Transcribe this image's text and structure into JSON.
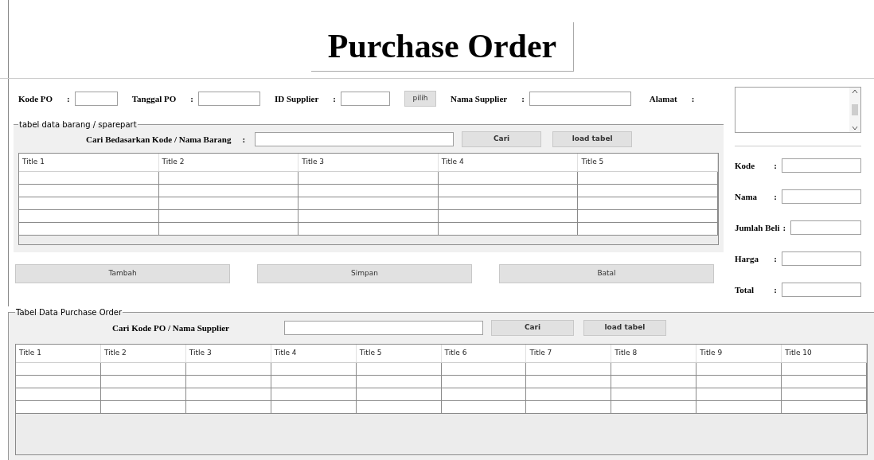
{
  "title": "Purchase Order",
  "header_fields": [
    {
      "label": "Kode PO",
      "colon": ":",
      "kind": "input"
    },
    {
      "label": "Tanggal PO",
      "colon": ":",
      "kind": "input"
    },
    {
      "label": "ID Supplier",
      "colon": ":",
      "kind": "input"
    },
    {
      "label": "pilih",
      "kind": "button"
    },
    {
      "label": "Nama Supplier",
      "colon": ":",
      "kind": "input"
    },
    {
      "label": "Alamat",
      "colon": ":",
      "kind": "label"
    }
  ],
  "item_group": {
    "legend": "tabel data barang / sparepart",
    "search_label": "Cari Bedasarkan Kode / Nama Barang",
    "colon": ":",
    "buttons": [
      "Cari",
      "load tabel"
    ],
    "columns": [
      "Title 1",
      "Title 2",
      "Title 3",
      "Title 4",
      "Title 5"
    ]
  },
  "actions": [
    "Tambah",
    "Simpan",
    "Batal"
  ],
  "item_fields": [
    {
      "label": "Kode",
      "colon": ":"
    },
    {
      "label": "Nama",
      "colon": ":"
    },
    {
      "label": "Jumlah Beli",
      "colon": ":"
    },
    {
      "label": "Harga",
      "colon": ":"
    },
    {
      "label": "Total",
      "colon": ":"
    }
  ],
  "po_group": {
    "legend": "Tabel Data Purchase Order",
    "search_label": "Cari Kode PO / Nama Supplier",
    "buttons": [
      "Cari",
      "load tabel"
    ],
    "columns": [
      "Title 1",
      "Title 2",
      "Title 3",
      "Title 4",
      "Title 5",
      "Title 6",
      "Title 7",
      "Title 8",
      "Title 9",
      "Title 10"
    ]
  }
}
